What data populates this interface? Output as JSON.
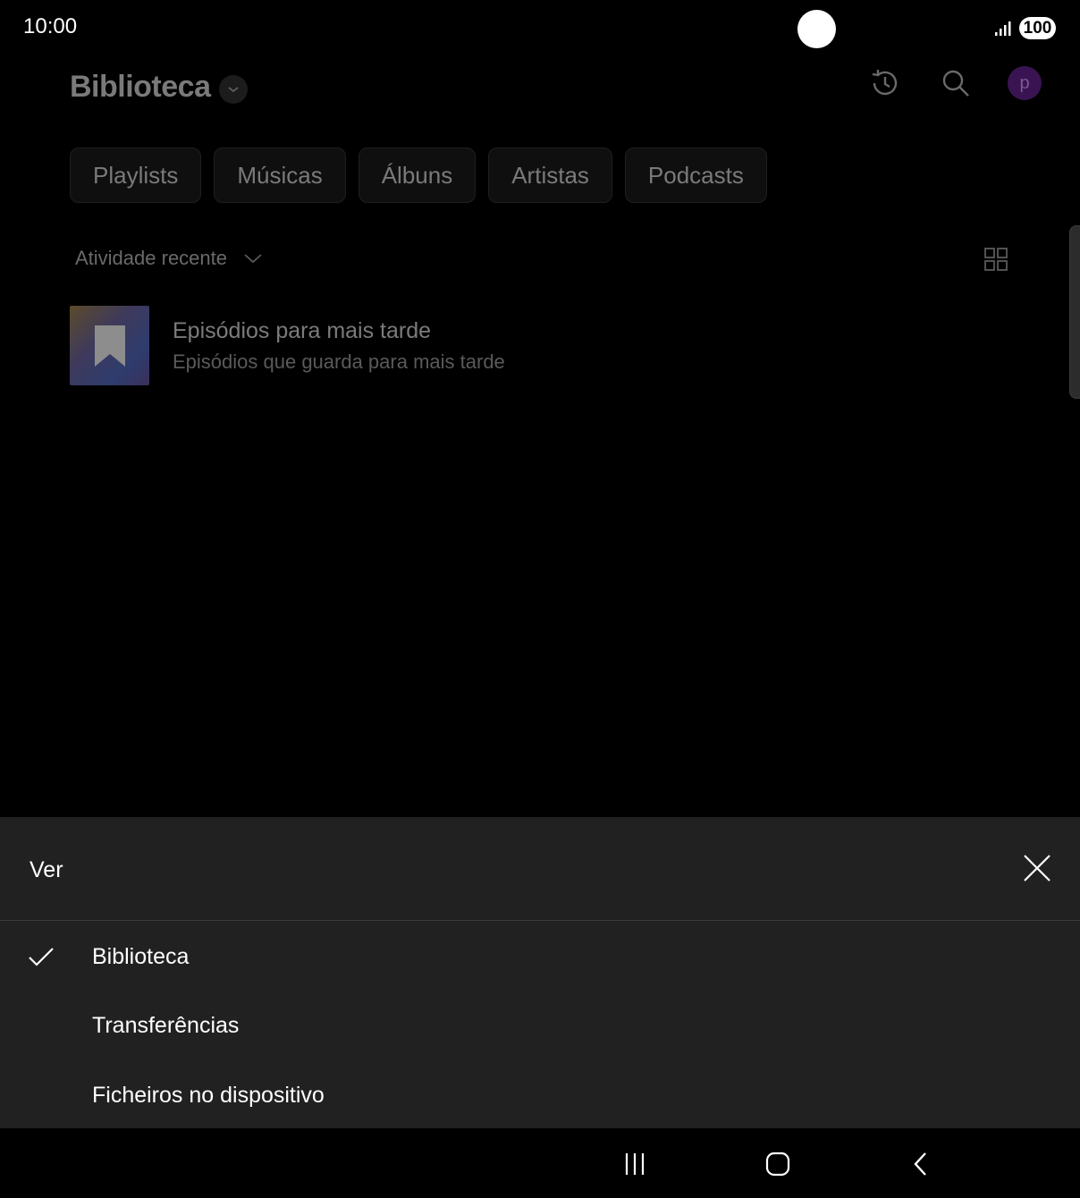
{
  "status_bar": {
    "time": "10:00",
    "battery": "100"
  },
  "header": {
    "title": "Biblioteca"
  },
  "chips": [
    "Playlists",
    "Músicas",
    "Álbuns",
    "Artistas",
    "Podcasts"
  ],
  "sort": {
    "label": "Atividade recente"
  },
  "library_items": [
    {
      "title": "Episódios para mais tarde",
      "subtitle": "Episódios que guarda para mais tarde",
      "icon": "bookmark-icon"
    }
  ],
  "avatar": {
    "initial": "p"
  },
  "sheet": {
    "title": "Ver",
    "options": [
      {
        "label": "Biblioteca",
        "selected": true
      },
      {
        "label": "Transferências",
        "selected": false
      },
      {
        "label": "Ficheiros no dispositivo",
        "selected": false
      }
    ]
  },
  "colors": {
    "sheet_bg": "#212121",
    "background": "#000000",
    "avatar": "#3a1452"
  }
}
